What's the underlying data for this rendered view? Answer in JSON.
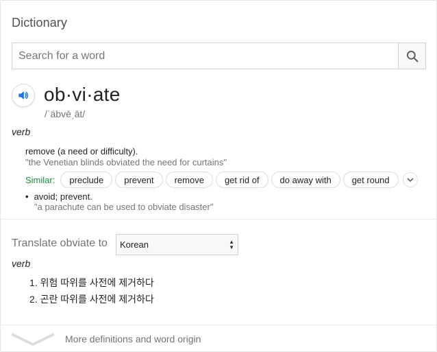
{
  "header": {
    "title": "Dictionary"
  },
  "search": {
    "placeholder": "Search for a word",
    "value": "",
    "button_icon": "search-icon"
  },
  "entry": {
    "audio_icon": "speaker-icon",
    "word": "ob·vi·ate",
    "phonetic": "/ˈäbvēˌāt/",
    "part_of_speech": "verb",
    "definitions": [
      {
        "text": "remove (a need or difficulty).",
        "example": "\"the Venetian blinds obviated the need for curtains\"",
        "similar_label": "Similar:",
        "similar": [
          "preclude",
          "prevent",
          "remove",
          "get rid of",
          "do away with",
          "get round"
        ],
        "expand_icon": "chevron-down-icon"
      },
      {
        "bullet": "•",
        "text": "avoid; prevent.",
        "example": "\"a parachute can be used to obviate disaster\""
      }
    ]
  },
  "translate": {
    "label": "Translate obviate to",
    "language": "Korean",
    "part_of_speech": "verb",
    "items": [
      {
        "num": "1.",
        "text": "위험 따위를 사전에 제거하다"
      },
      {
        "num": "2.",
        "text": "곤란 따위를 사전에 제거하다"
      }
    ]
  },
  "footer": {
    "more_label": "More definitions and word origin",
    "more_icon": "chevron-down-icon"
  },
  "colors": {
    "accent_blue": "#1a73e8",
    "similar_green": "#1e8e3e",
    "muted_text": "#70757a"
  }
}
